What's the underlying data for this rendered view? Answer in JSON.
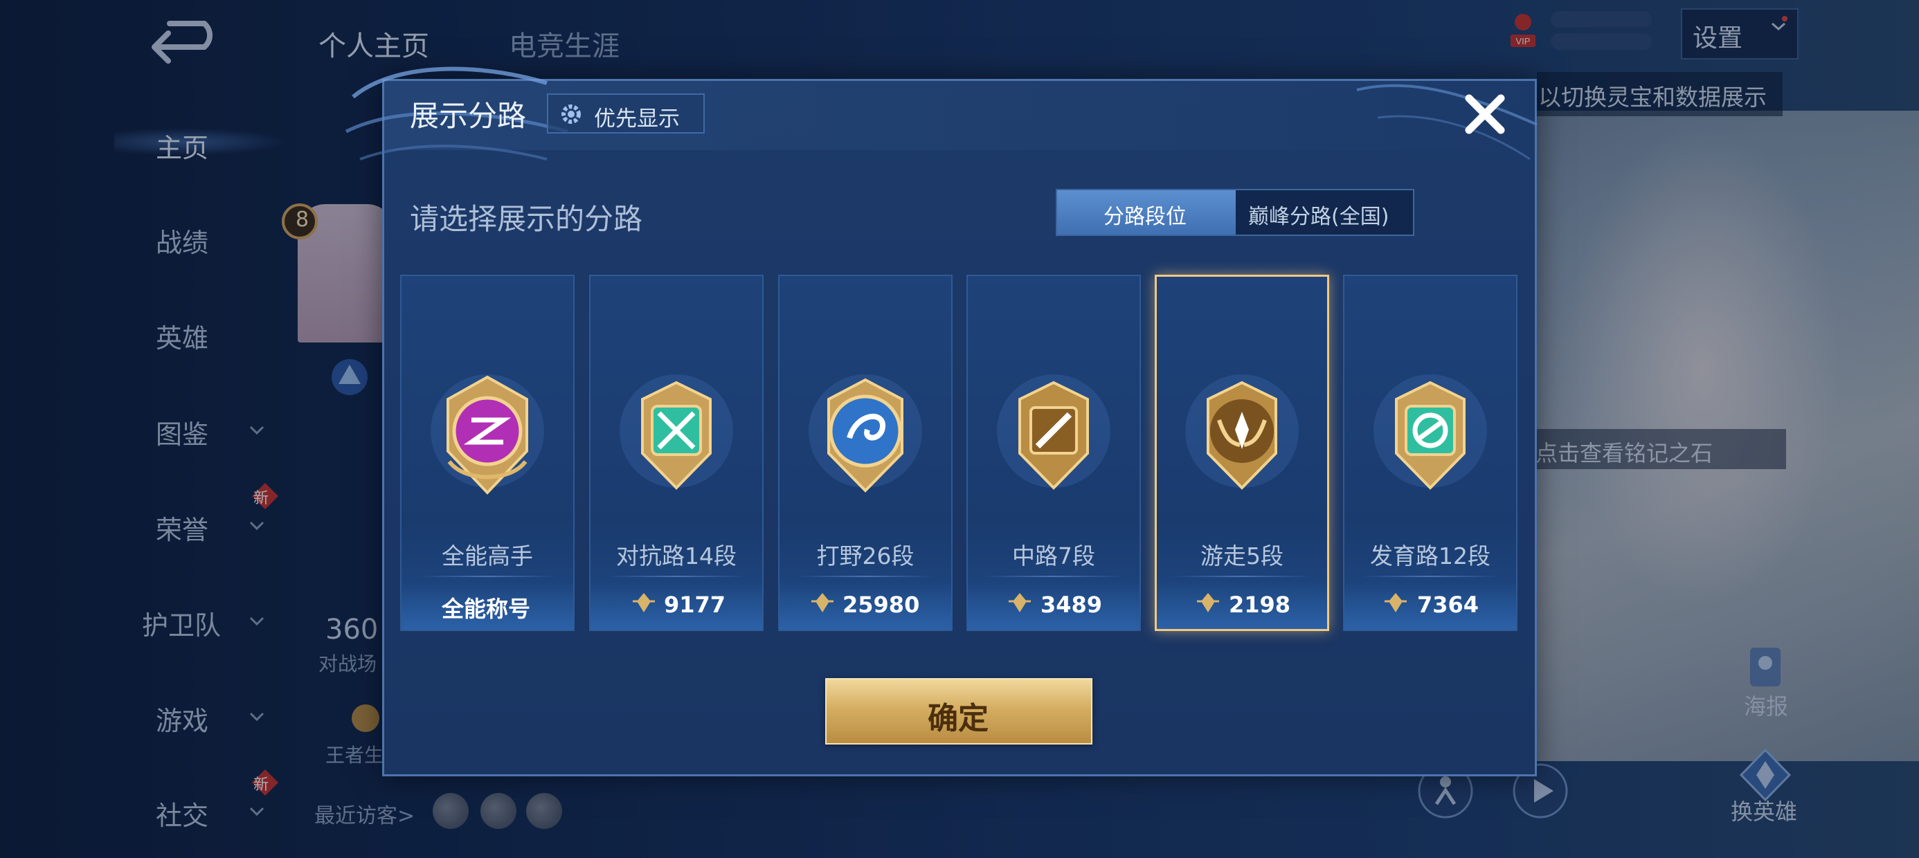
{
  "topbar": {
    "tabs": [
      {
        "label": "个人主页"
      },
      {
        "label": "电竞生涯"
      }
    ],
    "settings_label": "设置",
    "vip_label": "VIP",
    "hint_text": "以切换灵宝和数据展示"
  },
  "sidebar": {
    "items": [
      {
        "label": "主页",
        "active": true
      },
      {
        "label": "战绩"
      },
      {
        "label": "英雄"
      },
      {
        "label": "图鉴",
        "chevron": true
      },
      {
        "label": "荣誉",
        "chevron": true,
        "badge": "新"
      },
      {
        "label": "护卫队",
        "chevron": true
      },
      {
        "label": "游戏",
        "chevron": true
      },
      {
        "label": "社交",
        "chevron": true,
        "badge": "新"
      }
    ]
  },
  "profile": {
    "level": "8",
    "stat_value": "360",
    "stat_label": "对战场",
    "royal_label": "王者生",
    "visitors_label": "最近访客>"
  },
  "right_panel": {
    "inscription_hint": "点击查看铭记之石",
    "poster_label": "海报",
    "swap_hero_label": "换英雄"
  },
  "modal": {
    "title": "展示分路",
    "priority_label": "优先显示",
    "subtitle": "请选择展示的分路",
    "toggle": {
      "active": "分路段位",
      "inactive": "巅峰分路(全国)"
    },
    "cards": [
      {
        "name": "全能高手",
        "value": "全能称号",
        "emblem": "allround-emblem",
        "color": "#c23ec0"
      },
      {
        "name": "对抗路14段",
        "value": "9177",
        "emblem": "clash-lane-emblem",
        "color": "#2fbfa0"
      },
      {
        "name": "打野26段",
        "value": "25980",
        "emblem": "jungle-emblem",
        "color": "#2f74c9"
      },
      {
        "name": "中路7段",
        "value": "3489",
        "emblem": "mid-lane-emblem",
        "color": "#c89a44"
      },
      {
        "name": "游走5段",
        "value": "2198",
        "emblem": "roam-emblem",
        "color": "#b9863c",
        "selected": true
      },
      {
        "name": "发育路12段",
        "value": "7364",
        "emblem": "farm-lane-emblem",
        "color": "#2fbfa0"
      }
    ],
    "confirm_label": "确定",
    "close_icon": "close-icon"
  },
  "colors": {
    "accent_gold": "#f0c982",
    "panel_blue": "#1c3a69",
    "toggle_active": "#5c8fd0"
  }
}
